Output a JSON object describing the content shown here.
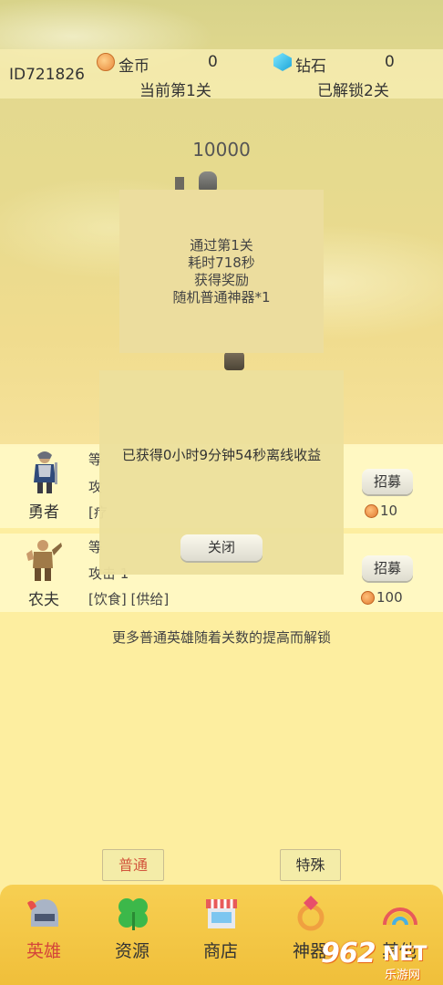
{
  "colors": {
    "active_tab": "#d2553c",
    "nav_background": "#f7cf52",
    "popup": "#ecdd9e"
  },
  "topbar": {
    "player_id": "ID721826",
    "coin_label": "金币",
    "coin_value": "0",
    "coin_icon": "coin-icon",
    "gem_label": "钻石",
    "gem_value": "0",
    "gem_icon": "diamond-icon",
    "current_level": "当前第1关",
    "unlocked": "已解锁2关"
  },
  "score": "10000",
  "reward_popup": {
    "line1": "通过第1关",
    "line2": "耗时718秒",
    "line3": "获得奖励",
    "line4": "随机普通神器*1"
  },
  "offline_popup": {
    "message": "已获得0小时9分钟54秒离线收益",
    "close_label": "关闭"
  },
  "heroes": [
    {
      "name": "勇者",
      "line1": "等",
      "line2": "攻",
      "line3": "[疗",
      "recruit_label": "招募",
      "cost": "10"
    },
    {
      "name": "农夫",
      "line1": "等",
      "line2": "攻击 1",
      "line3": "[饮食] [供给]",
      "recruit_label": "招募",
      "cost": "100"
    }
  ],
  "more_text": "更多普通英雄随着关数的提高而解锁",
  "tabs": {
    "normal": "普通",
    "special": "特殊"
  },
  "nav": [
    {
      "label": "英雄",
      "icon": "helmet-icon"
    },
    {
      "label": "资源",
      "icon": "clover-icon"
    },
    {
      "label": "商店",
      "icon": "shop-icon"
    },
    {
      "label": "神器",
      "icon": "ring-icon"
    },
    {
      "label": "其他",
      "icon": "rainbow-icon"
    }
  ],
  "watermark": {
    "brand": "962",
    "suffix": "NET",
    "site": "乐游网"
  }
}
